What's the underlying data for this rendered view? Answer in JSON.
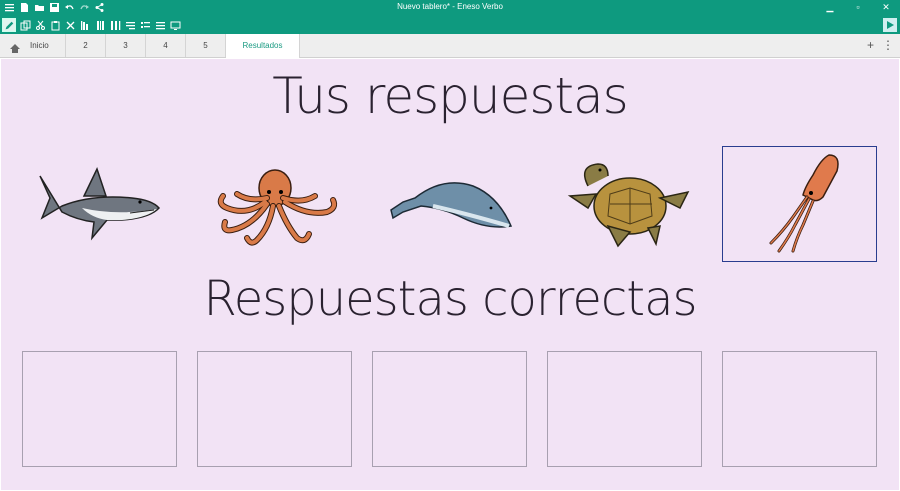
{
  "window": {
    "title": "Nuevo tablero* - Eneso Verbo",
    "controls": [
      "minimize-icon",
      "maximize-icon",
      "close-icon"
    ]
  },
  "toolbar": {
    "icons": [
      "menu-icon",
      "new-file-icon",
      "open-folder-icon",
      "save-icon",
      "undo-icon",
      "redo-icon",
      "share-icon"
    ],
    "edit_icons": [
      "edit-icon",
      "copy-icon",
      "cut-icon",
      "paste-icon",
      "delete-icon",
      "align-left-icon",
      "align-center-icon",
      "align-right-icon",
      "distribute-icon",
      "list-icon",
      "list-alt-icon",
      "screen-icon"
    ],
    "play_icon": "play-icon"
  },
  "tabs": [
    {
      "label": "Inicio",
      "icon": "home-icon"
    },
    {
      "label": "2"
    },
    {
      "label": "3"
    },
    {
      "label": "4"
    },
    {
      "label": "5"
    },
    {
      "label": "Resultados",
      "active": true
    }
  ],
  "board": {
    "background": "#f2e3f5",
    "your_answers_title": "Tus respuestas",
    "correct_answers_title": "Respuestas correctas",
    "your_answers": [
      "shark",
      "octopus",
      "whale",
      "turtle",
      "squid"
    ],
    "selected_answer": "squid",
    "correct_answer_slots": 5
  },
  "colors": {
    "accent": "#0e9a7f",
    "active_tab_text": "#1b9b83",
    "selection_border": "#2a3d8f"
  }
}
